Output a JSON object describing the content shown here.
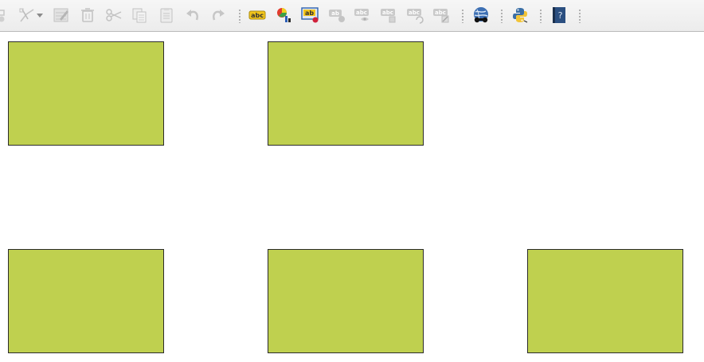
{
  "toolbar": {
    "label_text": "abc",
    "label_text_short": "ab",
    "help_glyph": "?",
    "buttons": [
      {
        "name": "move-feature-icon",
        "enabled": false
      },
      {
        "name": "node-tool-icon",
        "enabled": false
      },
      {
        "name": "node-tool-dropdown-icon",
        "enabled": false
      },
      {
        "name": "edit-attributes-icon",
        "enabled": false
      },
      {
        "name": "delete-selected-icon",
        "enabled": false
      },
      {
        "name": "cut-features-icon",
        "enabled": false
      },
      {
        "name": "copy-features-icon",
        "enabled": false
      },
      {
        "name": "paste-features-icon",
        "enabled": false
      },
      {
        "name": "undo-icon",
        "enabled": false
      },
      {
        "name": "redo-icon",
        "enabled": false
      },
      {
        "name": "layer-labeling-icon",
        "enabled": true
      },
      {
        "name": "layer-diagram-icon",
        "enabled": true
      },
      {
        "name": "label-pin-icon",
        "enabled": true
      },
      {
        "name": "show-hide-labels-icon",
        "enabled": false
      },
      {
        "name": "move-label-icon",
        "enabled": false
      },
      {
        "name": "rotate-label-icon",
        "enabled": false
      },
      {
        "name": "change-label-icon",
        "enabled": false
      },
      {
        "name": "globe-binoculars-icon",
        "enabled": true
      },
      {
        "name": "python-console-icon",
        "enabled": true
      },
      {
        "name": "help-book-icon",
        "enabled": true
      }
    ]
  },
  "canvas": {
    "background": "#ffffff",
    "feature_fill": "#bfd04f",
    "feature_stroke": "#2b2b2b",
    "features": [
      {
        "id": "feature-1"
      },
      {
        "id": "feature-2"
      },
      {
        "id": "feature-3"
      },
      {
        "id": "feature-4"
      },
      {
        "id": "feature-5"
      }
    ]
  }
}
